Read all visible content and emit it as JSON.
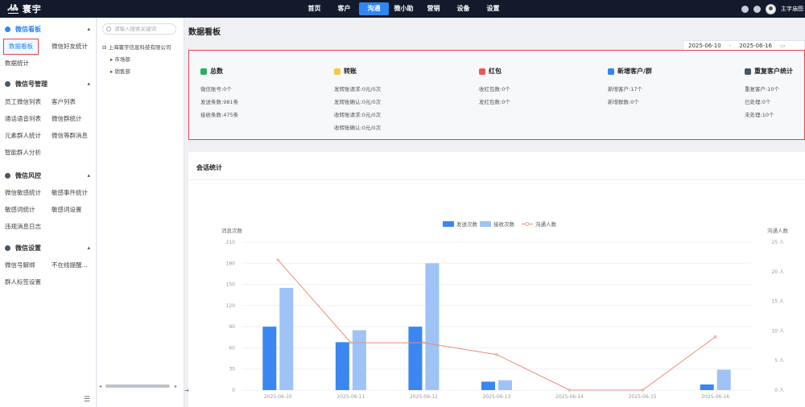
{
  "topbar": {
    "logo_mark": "ᏗᏜ",
    "logo_text": "寰宇",
    "nav": [
      {
        "label": "首页",
        "active": false
      },
      {
        "label": "客户",
        "active": false
      },
      {
        "label": "沟通",
        "active": true
      },
      {
        "label": "微小助",
        "active": false
      },
      {
        "label": "营销",
        "active": false
      },
      {
        "label": "设备",
        "active": false
      },
      {
        "label": "设置",
        "active": false
      }
    ],
    "username": "主字庙图"
  },
  "sidebar": {
    "groups": [
      {
        "title": "微信看板",
        "items": [
          "数据看板",
          "微信好友统计",
          "数据统计"
        ]
      },
      {
        "title": "微信号管理",
        "items": [
          "员工微信列表",
          "客户列表",
          "通话语音列表",
          "微信群统计",
          "元素群人统计",
          "微信等群消息",
          "智能群人分析"
        ]
      },
      {
        "title": "微信风控",
        "items": [
          "微信敏感统计",
          "敏感事件统计",
          "敏感词统计",
          "敏感词设置",
          "违规消息日志"
        ]
      },
      {
        "title": "微信设置",
        "items": [
          "微信号解绑",
          "不在线提醒…",
          "群人标签设置"
        ]
      }
    ]
  },
  "tree": {
    "search_placeholder": "请输入搜索关键词",
    "root": "上海寰宇信息科技有限公司",
    "children": [
      "市场部",
      "销售部"
    ]
  },
  "main": {
    "title": "数据看板",
    "date_start": "2025-06-10",
    "date_sep": "-",
    "date_end": "2025-06-16"
  },
  "stats": [
    {
      "title": "总数",
      "color": "#27ae60",
      "lines": [
        "微信账号:0个",
        "发送条数:981条",
        "接收条数:475条"
      ]
    },
    {
      "title": "转账",
      "color": "#f2c94c",
      "lines": [
        "发转账请求:0元/0次",
        "发转账确认:0元/0次",
        "收转账请求:0元/0次",
        "收转账确认:0元/0次"
      ]
    },
    {
      "title": "红包",
      "color": "#eb5757",
      "lines": [
        "收红包数:0个",
        "发红包数:0个"
      ]
    },
    {
      "title": "新增客户/群",
      "color": "#2f86f6",
      "lines": [
        "新增客户:17个",
        "新增群数:0个"
      ]
    },
    {
      "title": "重复客户统计",
      "color": "#4a5568",
      "lines": [
        "重复客户:10个",
        "已处理:0个",
        "未处理:10个"
      ]
    }
  ],
  "chart": {
    "title": "会话统计"
  },
  "chart_data": {
    "type": "bar",
    "categories": [
      "2025-06-10",
      "2025-06-11",
      "2025-06-12",
      "2025-06-13",
      "2025-06-14",
      "2025-06-15",
      "2025-06-16"
    ],
    "series": [
      {
        "name": "发送次数",
        "type": "bar",
        "axis": "left",
        "color": "#3b86f0",
        "values": [
          90,
          68,
          90,
          12,
          0,
          0,
          8
        ]
      },
      {
        "name": "接收次数",
        "type": "bar",
        "axis": "left",
        "color": "#9fc3f6",
        "values": [
          145,
          85,
          180,
          14,
          0,
          0,
          29
        ]
      },
      {
        "name": "沟通人数",
        "type": "line",
        "axis": "right",
        "color": "#ee8b78",
        "values": [
          22,
          8,
          8,
          6,
          0,
          0,
          9
        ]
      }
    ],
    "ylabel": "消息次数",
    "y2label": "沟通人数",
    "ylim": [
      0,
      200
    ],
    "yticks": [
      0,
      30,
      60,
      90,
      120,
      150,
      180,
      210
    ],
    "ytick_labels": [
      "0",
      "30",
      "60",
      "90",
      "120",
      "150",
      "180",
      "210"
    ],
    "y2lim": [
      0,
      25
    ],
    "y2ticks": [
      0,
      5,
      10,
      15,
      20,
      25
    ],
    "y2tick_labels": [
      "0 人",
      "5 人",
      "10 人",
      "15 人",
      "20 人",
      "25 人"
    ],
    "grid": true,
    "legend": "top-center"
  }
}
